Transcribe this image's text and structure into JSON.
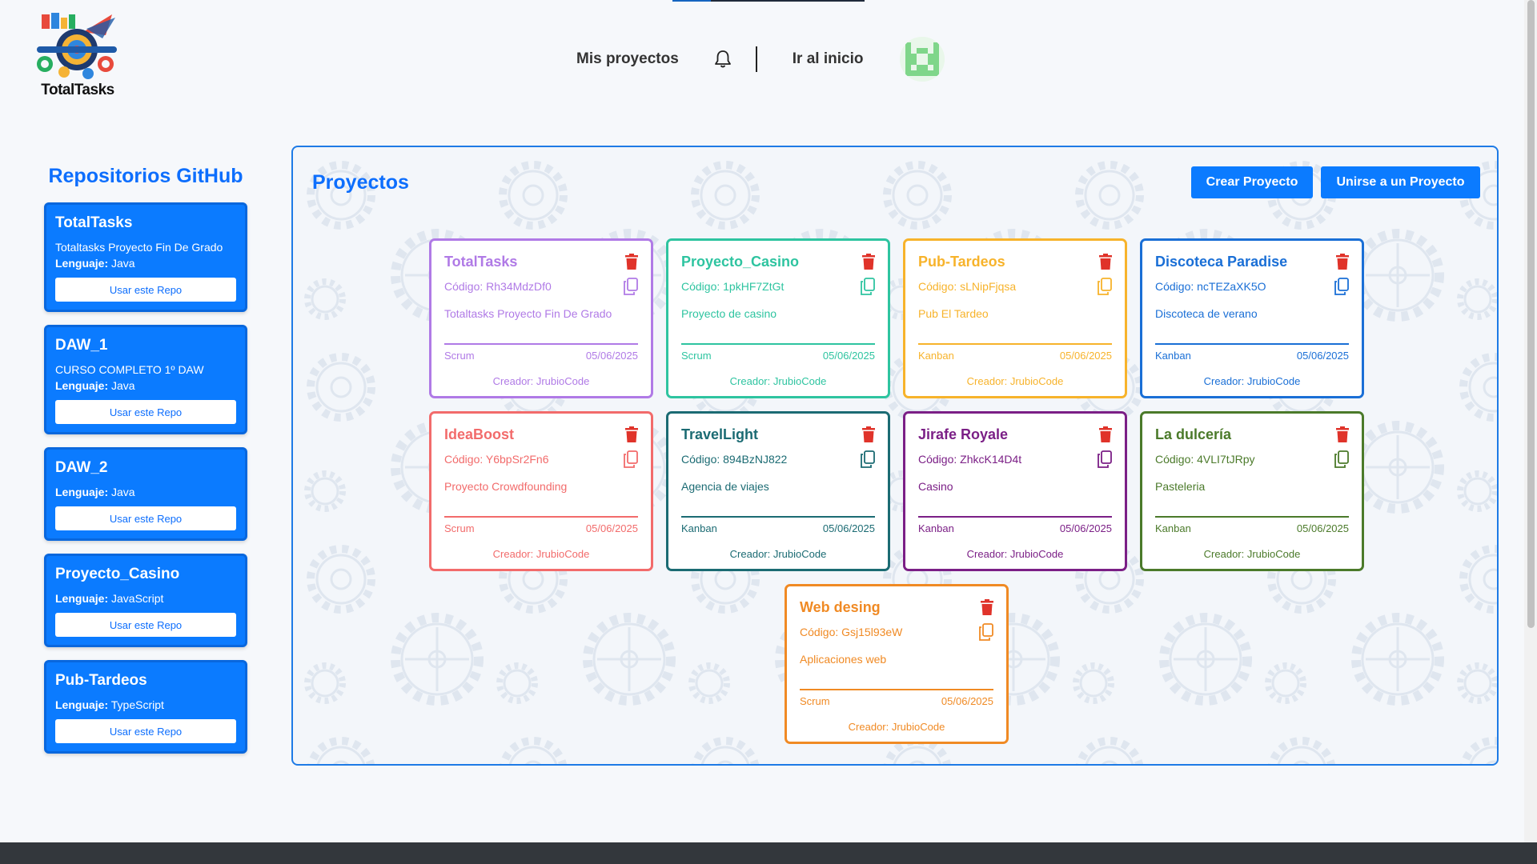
{
  "app": {
    "logo_text": "TotalTasks"
  },
  "nav": {
    "my_projects": "Mis proyectos",
    "home": "Ir al inicio"
  },
  "sidebar": {
    "title": "Repositorios GitHub",
    "lang_label": "Lenguaje:",
    "use_button": "Usar este Repo",
    "repos": [
      {
        "name": "TotalTasks",
        "desc": "Totaltasks Proyecto Fin De Grado",
        "lang": "Java"
      },
      {
        "name": "DAW_1",
        "desc": "CURSO COMPLETO 1º DAW",
        "lang": "Java"
      },
      {
        "name": "DAW_2",
        "desc": "",
        "lang": "Java"
      },
      {
        "name": "Proyecto_Casino",
        "desc": "",
        "lang": "JavaScript"
      },
      {
        "name": "Pub-Tardeos",
        "desc": "",
        "lang": "TypeScript"
      }
    ]
  },
  "panel": {
    "title": "Proyectos",
    "create_button": "Crear Proyecto",
    "join_button": "Unirse a un Proyecto"
  },
  "projects": [
    {
      "name": "TotalTasks",
      "code": "Código: Rh34MdzDf0",
      "desc": "Totaltasks Proyecto Fin De Grado",
      "method": "Scrum",
      "date": "05/06/2025",
      "creator": "Creador: JrubioCode",
      "color": "#b07ae6"
    },
    {
      "name": "Proyecto_Casino",
      "code": "Código: 1pkHF7ZtGt",
      "desc": "Proyecto de casino",
      "method": "Scrum",
      "date": "05/06/2025",
      "creator": "Creador: JrubioCode",
      "color": "#2ec4a0"
    },
    {
      "name": "Pub-Tardeos",
      "code": "Código: sLNipFjqsa",
      "desc": "Pub El Tardeo",
      "method": "Kanban",
      "date": "05/06/2025",
      "creator": "Creador: JrubioCode",
      "color": "#f7b32b"
    },
    {
      "name": "Discoteca Paradise",
      "code": "Código: ncTEZaXK5O",
      "desc": "Discoteca de verano",
      "method": "Kanban",
      "date": "05/06/2025",
      "creator": "Creador: JrubioCode",
      "color": "#1a6fd6"
    },
    {
      "name": "IdeaBoost",
      "code": "Código: Y6bpSr2Fn6",
      "desc": "Proyecto Crowdfounding",
      "method": "Scrum",
      "date": "05/06/2025",
      "creator": "Creador: JrubioCode",
      "color": "#f26b6b"
    },
    {
      "name": "TravelLight",
      "code": "Código: 894BzNJ822",
      "desc": "Agencia de viajes",
      "method": "Kanban",
      "date": "05/06/2025",
      "creator": "Creador: JrubioCode",
      "color": "#1b6b73"
    },
    {
      "name": "Jirafe Royale",
      "code": "Código: ZhkcK14D4t",
      "desc": "Casino",
      "method": "Kanban",
      "date": "05/06/2025",
      "creator": "Creador: JrubioCode",
      "color": "#7b1f86"
    },
    {
      "name": "La dulcería",
      "code": "Código: 4VLI7tJRpy",
      "desc": "Pasteleria",
      "method": "Kanban",
      "date": "05/06/2025",
      "creator": "Creador: JrubioCode",
      "color": "#4b7a2a"
    },
    {
      "name": "Web desing",
      "code": "Código: Gsj15l93eW",
      "desc": "Aplicaciones web",
      "method": "Scrum",
      "date": "05/06/2025",
      "creator": "Creador: JrubioCode",
      "color": "#f08a24"
    }
  ],
  "icons": {
    "bell": "bell-icon",
    "trash": "trash-icon",
    "copy": "copy-icon",
    "trash_color": "#e0332a"
  },
  "colors": {
    "accent": "#0b7bff",
    "title_blue": "#0d6efd"
  }
}
